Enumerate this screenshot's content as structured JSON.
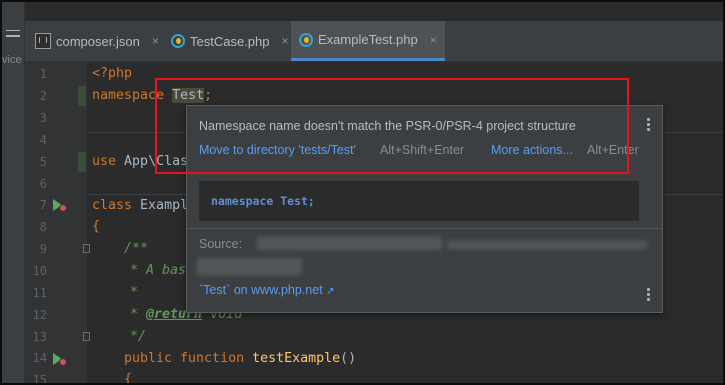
{
  "side_label": "vice",
  "tabs": [
    {
      "label": "composer.json",
      "icon": "json-file-icon"
    },
    {
      "label": "TestCase.php",
      "icon": "php-class-icon"
    },
    {
      "label": "ExampleTest.php",
      "icon": "php-class-icon",
      "active": true
    }
  ],
  "tab_close": "×",
  "line_numbers": [
    "1",
    "2",
    "3",
    "4",
    "5",
    "6",
    "7",
    "8",
    "9",
    "10",
    "11",
    "12",
    "13",
    "14",
    "15"
  ],
  "code": {
    "l1": "<?php",
    "l2_kw": "namespace",
    "l2_ns": "Test",
    "l2_end": ";",
    "l4_kw": "use",
    "l4_rest": "App\\Clas",
    "l6_kw": "class",
    "l6_rest": "Exampl",
    "l7": "{",
    "l8": "/**",
    "l9": "* A bas",
    "l10": "*",
    "l11_star": "* ",
    "l11_tag": "@return",
    "l11_rest": " void",
    "l12": "*/",
    "l13_kw": "public function",
    "l13_fn": "testExample",
    "l13_end": "()",
    "l14": "{"
  },
  "popup": {
    "message": "Namespace name doesn't match the PSR-0/PSR-4 project structure",
    "action1": "Move to directory 'tests/Test'",
    "shortcut1": "Alt+Shift+Enter",
    "action2": "More actions...",
    "shortcut2": "Alt+Enter",
    "code_preview": "namespace Test;",
    "source_label": "Source:",
    "doc_link": "`Test` on www.php.net",
    "doc_link_arrow": "↗"
  },
  "colors": {
    "highlight_box": "#e8121b",
    "link": "#589df6",
    "keyword": "#cc7832"
  }
}
